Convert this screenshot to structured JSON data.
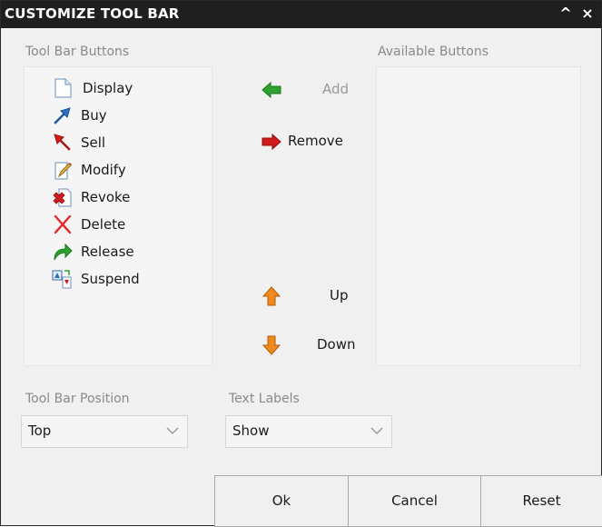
{
  "window": {
    "title": "CUSTOMIZE TOOL BAR",
    "collapse_symbol": "^",
    "close_symbol": "×"
  },
  "tool_bar_buttons": {
    "label": "Tool Bar Buttons",
    "items": [
      {
        "label": "Display",
        "icon": "document-icon"
      },
      {
        "label": "Buy",
        "icon": "buy-arrow-icon"
      },
      {
        "label": "Sell",
        "icon": "sell-arrow-icon"
      },
      {
        "label": "Modify",
        "icon": "edit-document-icon"
      },
      {
        "label": "Revoke",
        "icon": "revoke-document-icon"
      },
      {
        "label": "Delete",
        "icon": "delete-x-icon"
      },
      {
        "label": "Release",
        "icon": "release-arrow-icon"
      },
      {
        "label": "Suspend",
        "icon": "suspend-icon"
      }
    ]
  },
  "available_buttons": {
    "label": "Available Buttons",
    "items": []
  },
  "actions": {
    "add": {
      "label": "Add",
      "icon": "left-green-arrow-icon",
      "enabled": false
    },
    "remove": {
      "label": "Remove",
      "icon": "right-red-arrow-icon",
      "enabled": true
    },
    "up": {
      "label": "Up",
      "icon": "up-orange-arrow-icon",
      "enabled": true
    },
    "down": {
      "label": "Down",
      "icon": "down-orange-arrow-icon",
      "enabled": true
    }
  },
  "position": {
    "label": "Tool Bar Position",
    "value": "Top"
  },
  "text_labels": {
    "label": "Text Labels",
    "value": "Show"
  },
  "footer": {
    "ok": "Ok",
    "cancel": "Cancel",
    "reset": "Reset"
  },
  "colors": {
    "titlebar": "#1f1f1f",
    "panel": "#f0f0f0",
    "list_bg": "#f5f5f5",
    "green": "#2fa12f",
    "red": "#d21c1c",
    "orange": "#f08a1c"
  }
}
